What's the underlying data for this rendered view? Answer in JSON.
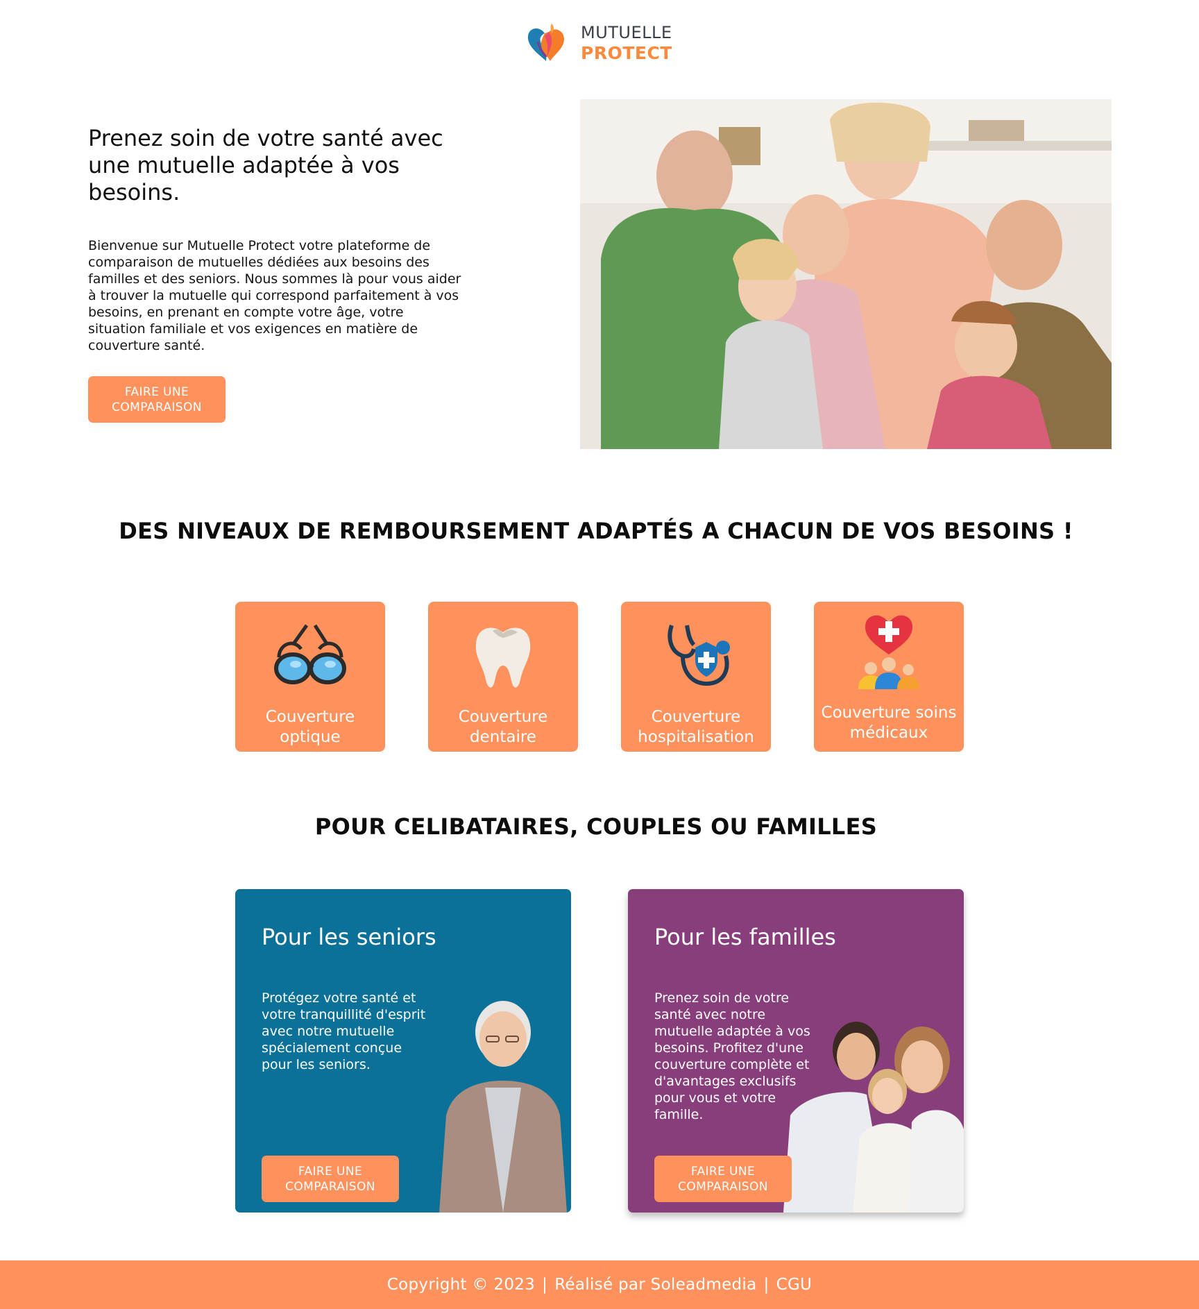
{
  "logo": {
    "line1": "MUTUELLE",
    "line2": "PROTECT"
  },
  "hero": {
    "title": "Prenez soin de votre santé avec une mutuelle adaptée à vos besoins.",
    "text": "Bienvenue sur Mutuelle Protect votre plateforme de comparaison de mutuelles dédiées aux besoins des familles et des seniors. Nous sommes là pour vous aider à trouver la mutuelle qui correspond parfaitement à vos besoins, en prenant en compte votre âge, votre situation familiale et vos exigences en matière de couverture santé.",
    "button_label": "FAIRE UNE COMPARAISON"
  },
  "section_coverage": {
    "title": "DES NIVEAUX DE REMBOURSEMENT ADAPTÉS A CHACUN DE VOS BESOINS !",
    "cards": [
      {
        "label": "Couverture optique",
        "icon": "glasses-icon"
      },
      {
        "label": "Couverture dentaire",
        "icon": "tooth-icon"
      },
      {
        "label": "Couverture hospitalisation",
        "icon": "stethoscope-shield-icon"
      },
      {
        "label": "Couverture soins médicaux",
        "icon": "family-heart-icon"
      }
    ]
  },
  "section_audience": {
    "title": "POUR CELIBATAIRES, COUPLES OU FAMILLES",
    "seniors": {
      "title": "Pour les seniors",
      "text": "Protégez votre santé et votre tranquillité d'esprit avec notre mutuelle spécialement conçue pour les seniors.",
      "button_label": "FAIRE UNE COMPARAISON"
    },
    "familles": {
      "title": "Pour les familles",
      "text": "Prenez soin de votre santé avec notre mutuelle adaptée à vos besoins. Profitez d'une couverture complète et d'avantages exclusifs pour vous et votre famille.",
      "button_label": "FAIRE UNE COMPARAISON"
    }
  },
  "footer": {
    "copyright": "Copyright © 2023",
    "credit": "Réalisé par Soleadmedia",
    "cgu": "CGU"
  },
  "colors": {
    "accent": "#fe915c",
    "seniors_bg": "#0b7199",
    "familles_bg": "#893e7c"
  }
}
